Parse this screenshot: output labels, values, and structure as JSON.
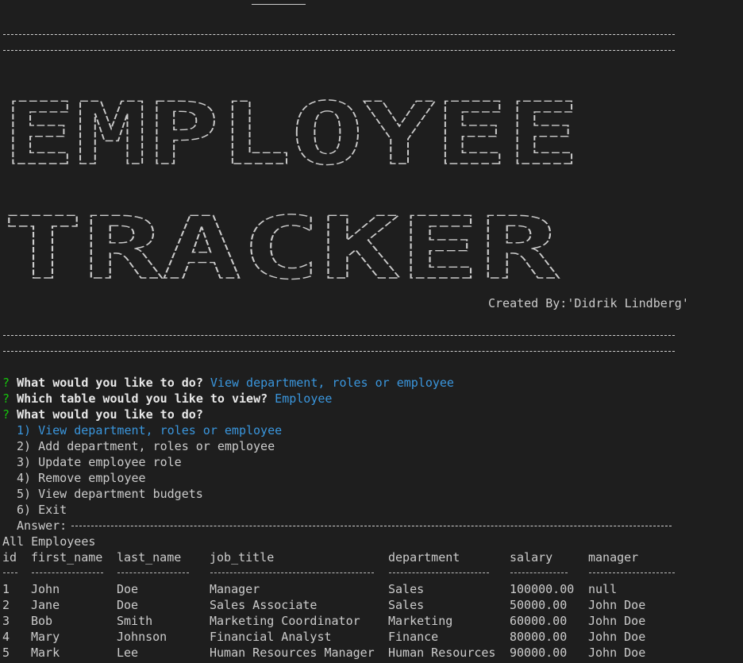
{
  "banner": {
    "line1": "EMPLOYEE",
    "line2": "TRACKER",
    "credit": "Created By:'Didrik Lindberg'"
  },
  "prompts": [
    {
      "mark": "?",
      "question": "What would you like to do?",
      "answer": "View department, roles or employee"
    },
    {
      "mark": "?",
      "question": "Which table would you like to view?",
      "answer": "Employee"
    },
    {
      "mark": "?",
      "question": "What would you like to do?",
      "answer": ""
    }
  ],
  "menu": {
    "options": [
      {
        "label": "1) View department, roles or employee"
      },
      {
        "label": "2) Add department, roles or employee"
      },
      {
        "label": "3) Update employee role"
      },
      {
        "label": "4) Remove employee"
      },
      {
        "label": "5) View department budgets"
      },
      {
        "label": "6) Exit"
      }
    ],
    "answer_label": "Answer:"
  },
  "table": {
    "title": "All Employees",
    "columns": [
      "id",
      "first_name",
      "last_name",
      "job_title",
      "department",
      "salary",
      "manager"
    ],
    "rows": [
      [
        "1",
        "John",
        "Doe",
        "Manager",
        "Sales",
        "100000.00",
        "null"
      ],
      [
        "2",
        "Jane",
        "Doe",
        "Sales Associate",
        "Sales",
        "50000.00",
        "John Doe"
      ],
      [
        "3",
        "Bob",
        "Smith",
        "Marketing Coordinator",
        "Marketing",
        "60000.00",
        "John Doe"
      ],
      [
        "4",
        "Mary",
        "Johnson",
        "Financial Analyst",
        "Finance",
        "80000.00",
        "John Doe"
      ],
      [
        "5",
        "Mark",
        "Lee",
        "Human Resources Manager",
        "Human Resources",
        "90000.00",
        "John Doe"
      ]
    ]
  },
  "colors": {
    "background": "#1e1e1e",
    "text": "#cccccc",
    "question_mark": "#16c60c",
    "answer": "#3a96dd"
  }
}
